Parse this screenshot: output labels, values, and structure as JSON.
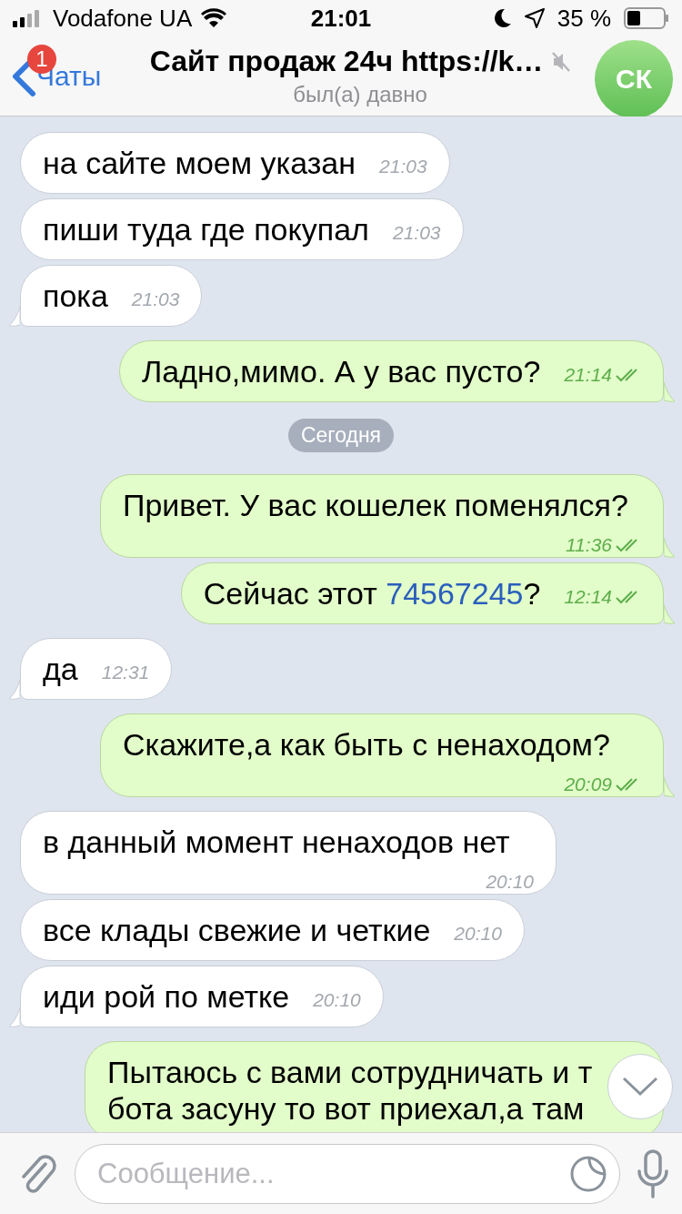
{
  "status_bar": {
    "carrier": "Vodafone UA",
    "time": "21:01",
    "battery": "35 %"
  },
  "header": {
    "back_label": "Чаты",
    "unread_badge": "1",
    "title": "Сайт продаж 24ч https://k…",
    "muted": true,
    "subtitle": "был(а) давно",
    "avatar_initials": "СК"
  },
  "messages": [
    {
      "kind": "in",
      "parts": [
        {
          "text": "на сайте моем указан",
          "link": false
        }
      ],
      "time": "21:03",
      "tail": false
    },
    {
      "kind": "in",
      "parts": [
        {
          "text": "пиши туда где покупал",
          "link": false
        }
      ],
      "time": "21:03",
      "tail": false
    },
    {
      "kind": "in",
      "parts": [
        {
          "text": "пока",
          "link": false
        }
      ],
      "time": "21:03",
      "tail": true
    },
    {
      "kind": "out",
      "parts": [
        {
          "text": "Ладно,мимо. А у вас пусто?",
          "link": false
        }
      ],
      "time": "21:14",
      "read": true,
      "tail": true
    },
    {
      "kind": "date",
      "text": "Сегодня"
    },
    {
      "kind": "out",
      "parts": [
        {
          "text": "Привет. У вас кошелек поменялся?",
          "link": false
        }
      ],
      "time": "11:36",
      "read": true,
      "tail": true
    },
    {
      "kind": "out",
      "parts": [
        {
          "text": "Сейчас этот ",
          "link": false
        },
        {
          "text": "74567245",
          "link": true
        },
        {
          "text": "?",
          "link": false
        }
      ],
      "time": "12:14",
      "read": true,
      "tail": true
    },
    {
      "kind": "in",
      "parts": [
        {
          "text": "да",
          "link": false
        }
      ],
      "time": "12:31",
      "tail": true
    },
    {
      "kind": "out",
      "parts": [
        {
          "text": "Скажите,а как быть с ненаходом?",
          "link": false
        }
      ],
      "time": "20:09",
      "read": true,
      "tail": true
    },
    {
      "kind": "in",
      "parts": [
        {
          "text": "в данный момент ненаходов нет",
          "link": false
        }
      ],
      "time": "20:10",
      "tail": false
    },
    {
      "kind": "in",
      "parts": [
        {
          "text": "все клады свежие и четкие",
          "link": false
        }
      ],
      "time": "20:10",
      "tail": false
    },
    {
      "kind": "in",
      "parts": [
        {
          "text": "иди рой по метке",
          "link": false
        }
      ],
      "time": "20:10",
      "tail": true
    },
    {
      "kind": "out",
      "lines": [
        "Пытаюсь с вами сотрудничать и т",
        "бота засуну то вот приехал,а там"
      ],
      "tail": false
    }
  ],
  "composer": {
    "placeholder": "Сообщение..."
  }
}
